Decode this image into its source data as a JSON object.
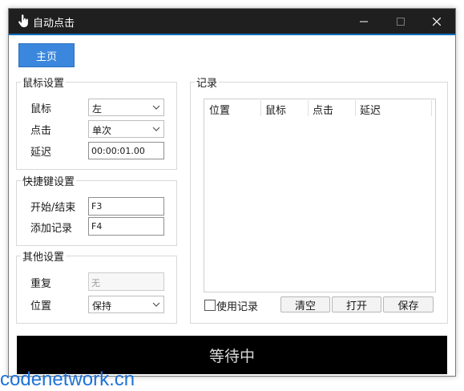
{
  "window": {
    "title": "自动点击",
    "icon": "hand-pointer-icon",
    "accent_color": "#0f6cbd",
    "titlebar_color": "#1f1f1f"
  },
  "toolbar": {
    "home_label": "主页"
  },
  "mouse_settings": {
    "title": "鼠标设置",
    "button_label": "鼠标",
    "button_value": "左",
    "click_label": "点击",
    "click_value": "单次",
    "delay_label": "延迟",
    "delay_value": "00:00:01.00"
  },
  "hotkeys": {
    "title": "快捷键设置",
    "start_stop_label": "开始/结束",
    "start_stop_value": "F3",
    "add_record_label": "添加记录",
    "add_record_value": "F4"
  },
  "other": {
    "title": "其他设置",
    "repeat_label": "重复",
    "repeat_value": "无",
    "position_label": "位置",
    "position_value": "保持"
  },
  "records": {
    "title": "记录",
    "columns": [
      "位置",
      "鼠标",
      "点击",
      "延迟"
    ],
    "use_records_label": "使用记录",
    "use_records_checked": false,
    "clear_label": "清空",
    "open_label": "打开",
    "save_label": "保存"
  },
  "status": {
    "text": "等待中"
  },
  "watermark": "codenetwork.cn"
}
